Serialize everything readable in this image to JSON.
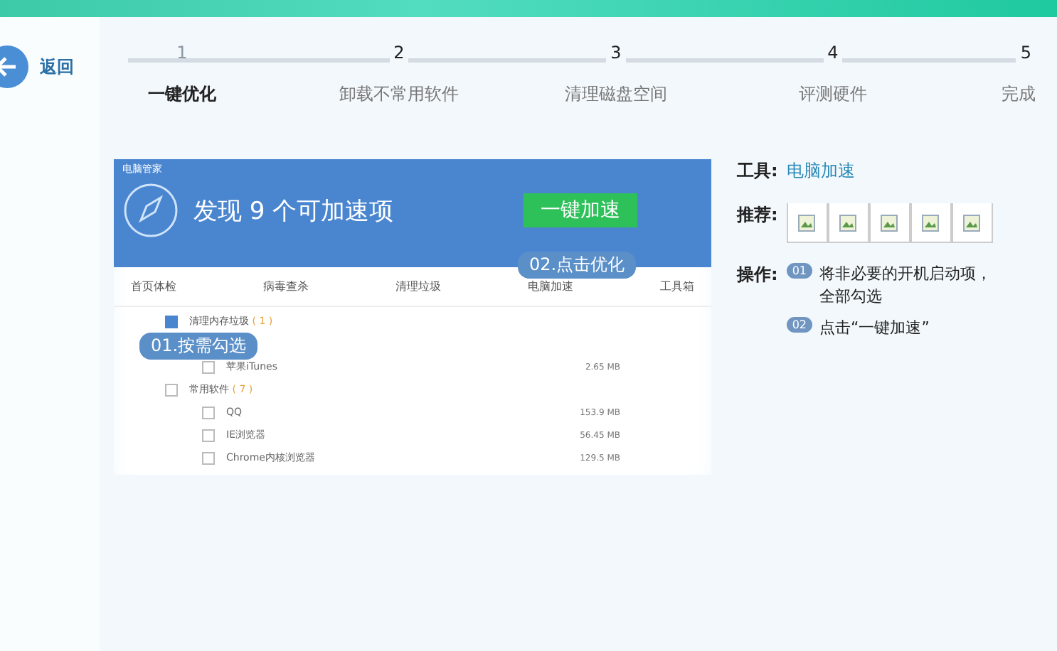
{
  "back": {
    "label": "返回"
  },
  "steps": [
    {
      "number": "1",
      "label": "一键优化",
      "selected": true
    },
    {
      "number": "2",
      "label": "卸载不常用软件",
      "selected": false
    },
    {
      "number": "3",
      "label": "清理磁盘空间",
      "selected": false
    },
    {
      "number": "4",
      "label": "评测硬件",
      "selected": false
    },
    {
      "number": "5",
      "label": "完成",
      "selected": false
    }
  ],
  "app": {
    "title": "电脑管家",
    "headline": "发现 9 个可加速项",
    "action": "一键加速",
    "callout_2": "02.点击优化",
    "callout_1": "01.按需勾选",
    "nav": [
      "首页体检",
      "病毒查杀",
      "清理垃圾",
      "电脑加速",
      "工具箱"
    ],
    "groups": [
      {
        "name": "清理内存垃圾",
        "count": "( 1 )",
        "checked": true
      },
      {
        "items": [
          {
            "name": "苹果iTunes",
            "size": "2.65 MB",
            "checked": false
          }
        ]
      },
      {
        "name": "常用软件",
        "count": "( 7 )",
        "checked": false,
        "items": [
          {
            "name": "QQ",
            "size": "153.9 MB",
            "checked": false
          },
          {
            "name": "IE浏览器",
            "size": "56.45 MB",
            "checked": false
          },
          {
            "name": "Chrome内核浏览器",
            "size": "129.5 MB",
            "checked": false
          }
        ]
      }
    ]
  },
  "info": {
    "tool_label": "工具:",
    "tool_link": "电脑加速",
    "recommend_label": "推荐:",
    "ops_label": "操作:",
    "ops": [
      {
        "number": "01",
        "text": "将非必要的开机启动项，全部勾选"
      },
      {
        "number": "02",
        "text": "点击“一键加速”"
      }
    ]
  }
}
